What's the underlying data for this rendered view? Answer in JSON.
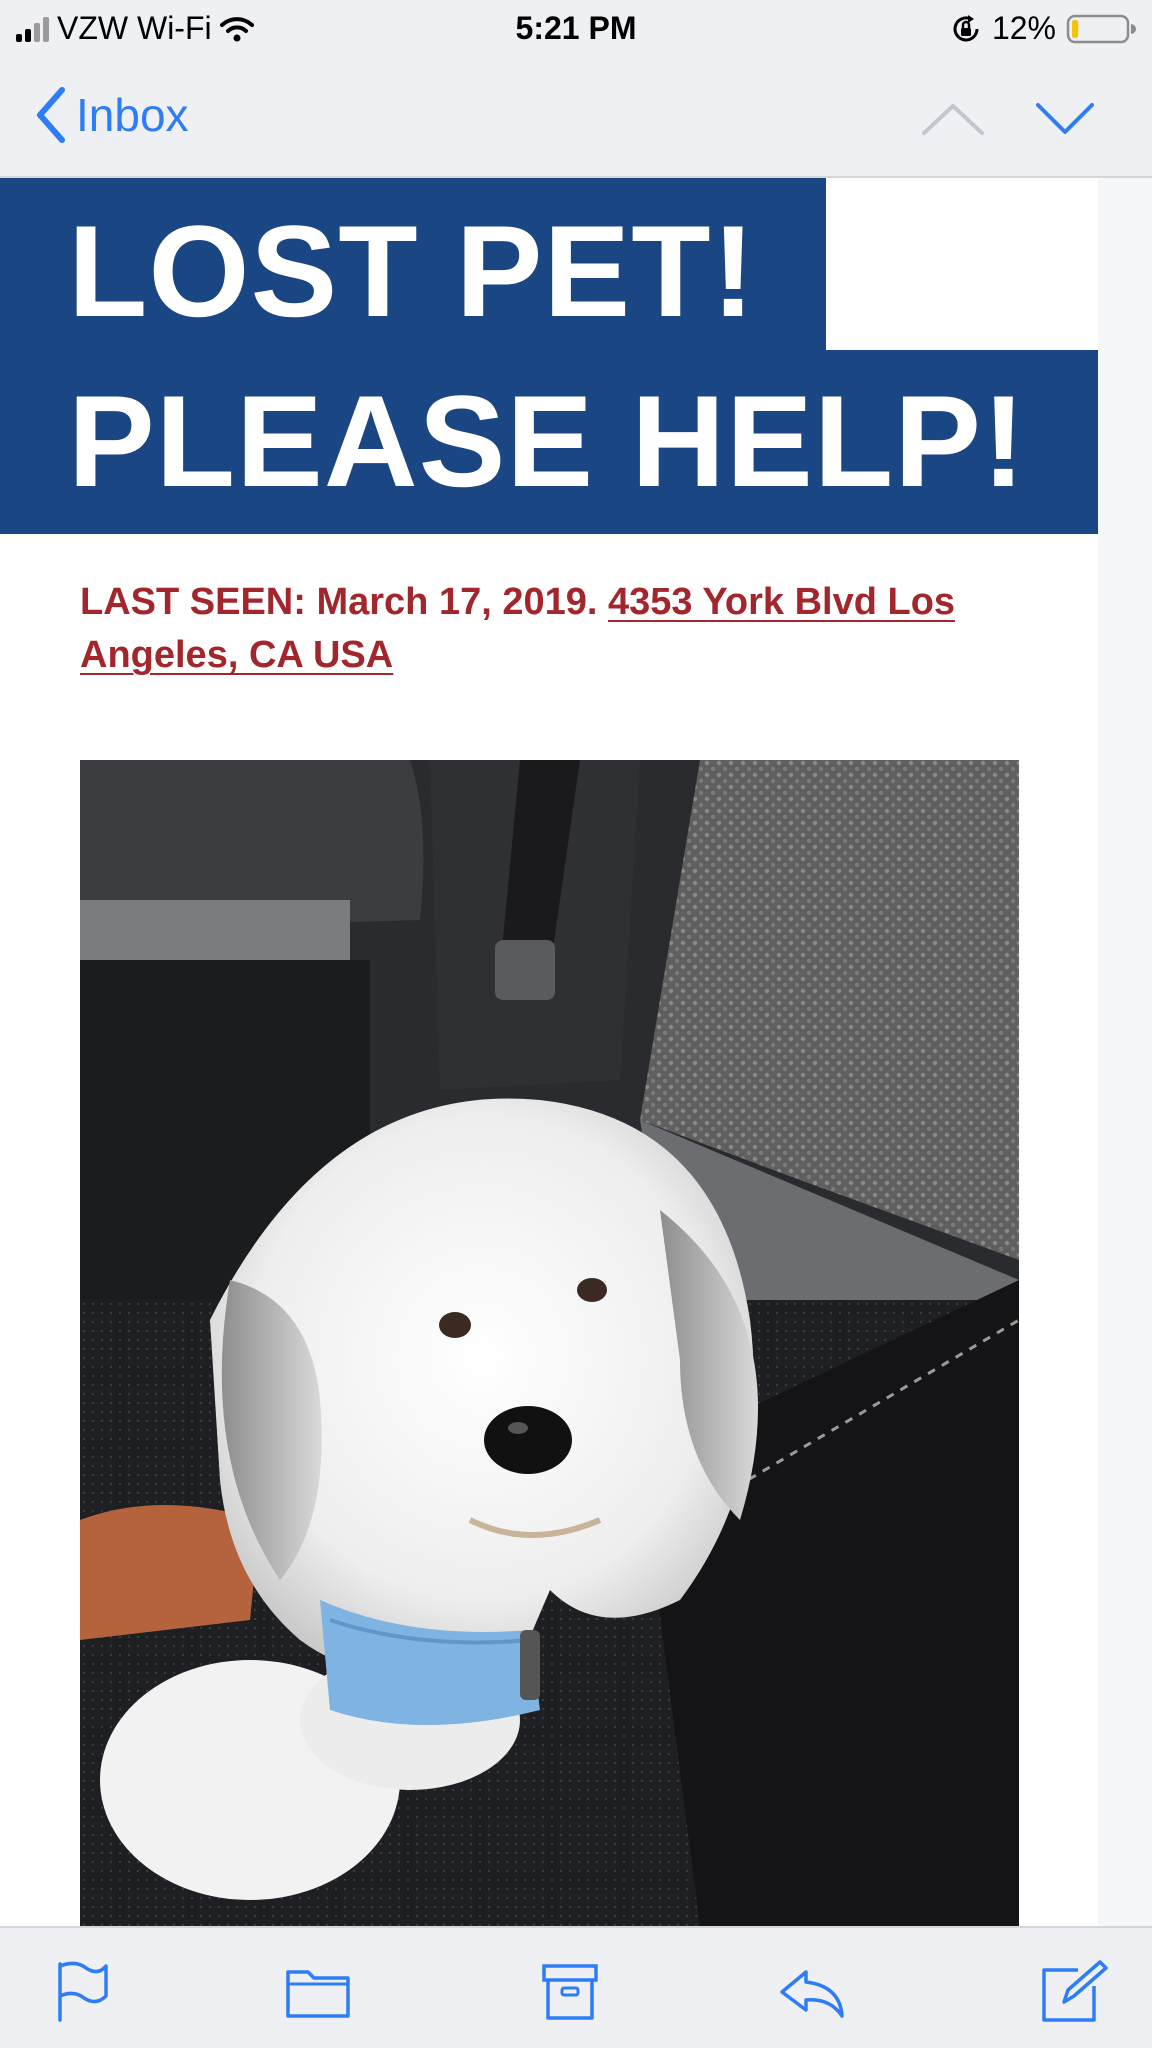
{
  "status_bar": {
    "carrier": "VZW Wi-Fi",
    "time": "5:21 PM",
    "battery_percent": "12%",
    "battery_level": 0.12,
    "signal_bars": 2
  },
  "nav": {
    "back_label": "Inbox"
  },
  "email": {
    "headline_line1": "LOST PET!",
    "headline_line2": "PLEASE HELP!",
    "last_seen_prefix": "LAST SEEN: March 17, 2019.",
    "last_seen_address": "4353 York Blvd Los Angeles, CA USA",
    "banner_color": "#1b4684",
    "alert_text_color": "#a2272d"
  },
  "toolbar": {
    "icons": [
      "flag-icon",
      "folder-icon",
      "archive-icon",
      "reply-icon",
      "compose-icon"
    ]
  },
  "colors": {
    "accent": "#2f7df6"
  }
}
